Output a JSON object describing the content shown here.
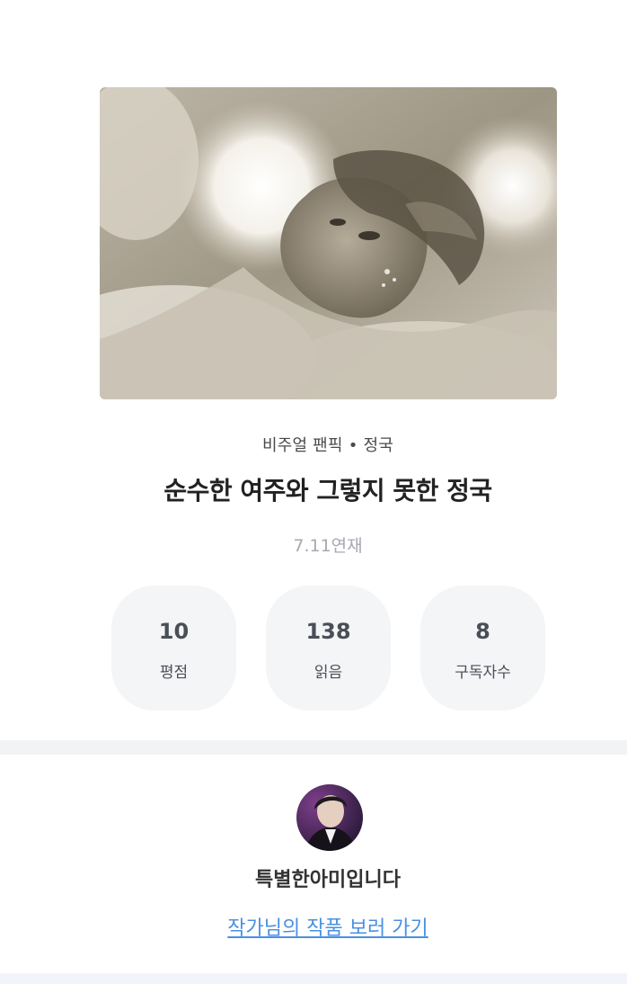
{
  "work": {
    "category": "비주얼 팬픽",
    "separator": "•",
    "tag": "정국",
    "title": "순수한 여주와 그렇지 못한 정국",
    "schedule": "7.11연재"
  },
  "stats": {
    "rating": {
      "value": "10",
      "label": "평점"
    },
    "reads": {
      "value": "138",
      "label": "읽음"
    },
    "subscribers": {
      "value": "8",
      "label": "구독자수"
    }
  },
  "author": {
    "name": "특별한아미입니다",
    "link_label": "작가님의 작품 보러 가기"
  },
  "colors": {
    "link": "#4a90e2",
    "stat_bg": "#f4f5f7",
    "muted": "#a5a9b0"
  }
}
